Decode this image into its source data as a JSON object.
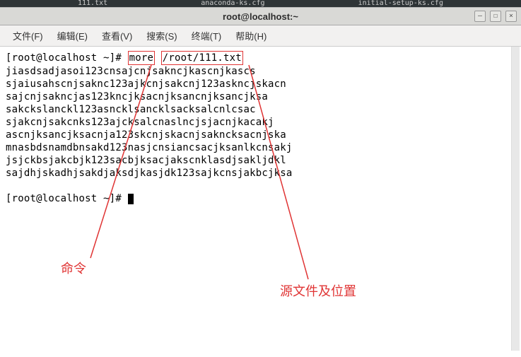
{
  "desktop": {
    "bg_file_left": "111.txt",
    "bg_file_center": "anaconda-ks.cfg",
    "bg_file_right": "initial-setup-ks.cfg"
  },
  "window": {
    "title": "root@localhost:~"
  },
  "menubar": {
    "items": [
      {
        "label": "文件(F)"
      },
      {
        "label": "编辑(E)"
      },
      {
        "label": "查看(V)"
      },
      {
        "label": "搜索(S)"
      },
      {
        "label": "终端(T)"
      },
      {
        "label": "帮助(H)"
      }
    ]
  },
  "terminal": {
    "prompt1_pre": "[root@localhost ~]# ",
    "cmd_box": "more",
    "cmd_space": " ",
    "arg_box": "/root/111.txt",
    "output": [
      "jiasdsadjasoi123cnsajcnjsakncjkascnjkascs",
      "sjaiusahscnjsaknc123ajkcnjsakcnj123askncjskacn",
      "sajcnjsakncjas123kncjksacnjksancnjksancjksa",
      "sakckslanckl123asncklsancklsacksalcnlcsac",
      "sjakcnjsakcnks123ajcksalcnaslncjsjacnjkacakj",
      "ascnjksancjksacnja123skcnjskacnjsakncksacnjska",
      "mnasbdsnamdbnsakd123nasjcnsiancsacjksanlkcnsakj",
      "jsjckbsjakcbjk123sacbjksacjakscnklasdjsakljdkl",
      "sajdhjskadhjsakdjaksdjkasjdk123sajkcnsjakbcjksa"
    ],
    "prompt2": "[root@localhost ~]# "
  },
  "annotations": {
    "cmd_label": "命令",
    "arg_label": "源文件及位置"
  },
  "colors": {
    "annotation_red": "#e03434",
    "box_red": "#e03434"
  }
}
